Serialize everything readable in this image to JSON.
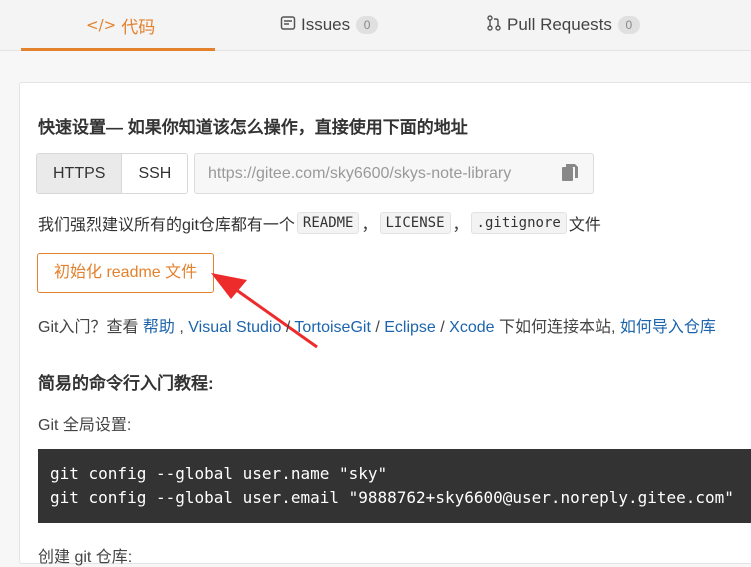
{
  "tabs": [
    {
      "label": "代码",
      "icon": "code-icon",
      "active": true
    },
    {
      "label": "Issues",
      "icon": "issues-icon",
      "count": "0"
    },
    {
      "label": "Pull Requests",
      "icon": "pull-request-icon",
      "count": "0"
    }
  ],
  "quick_setup": {
    "title": "快速设置— 如果你知道该怎么操作，直接使用下面的地址",
    "protocols": [
      "HTTPS",
      "SSH"
    ],
    "url": "https://gitee.com/sky6600/skys-note-library",
    "copy_icon": "copy-icon"
  },
  "recommend": {
    "prefix": "我们强烈建议所有的git仓库都有一个",
    "files": [
      "README",
      "LICENSE",
      ".gitignore"
    ],
    "sep": "，",
    "suffix": "文件"
  },
  "init_button": "初始化 readme 文件",
  "help": {
    "prefix": "Git入门？查看 ",
    "links": [
      "帮助",
      "Visual Studio",
      "TortoiseGit",
      "Eclipse",
      "Xcode"
    ],
    "middle": " 下如何连接本站,",
    "last_link": " 如何导入仓库"
  },
  "tutorial": {
    "title": "简易的命令行入门教程:",
    "global_label": "Git 全局设置:",
    "commands": [
      "git config --global user.name \"sky\"",
      "git config --global user.email \"9888762+sky6600@user.noreply.gitee.com\""
    ],
    "next_label": "创建 git 仓库:"
  },
  "colors": {
    "accent": "#e4812c",
    "link": "#1c64ad",
    "arrow": "#ee2b2b",
    "code_bg": "#333333"
  }
}
